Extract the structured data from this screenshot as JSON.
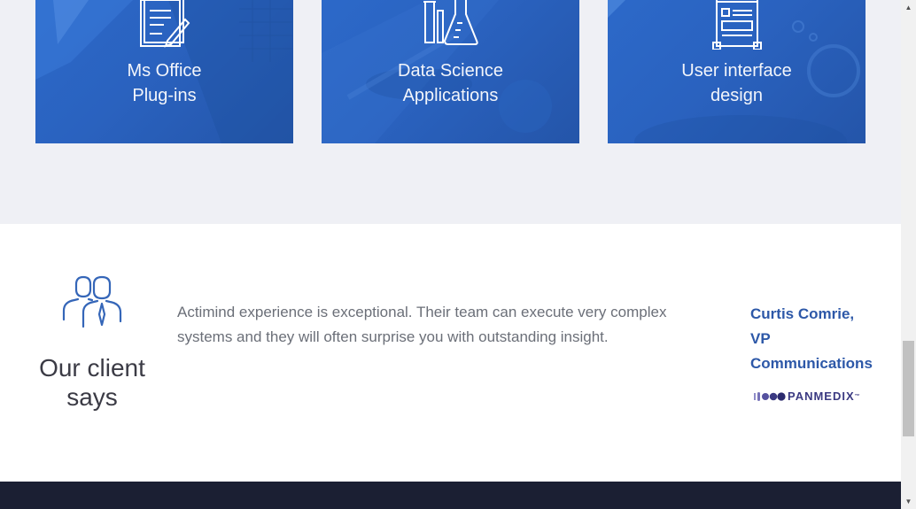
{
  "services": {
    "cards": [
      {
        "line1": "Ms Office",
        "line2": "Plug-ins",
        "icon": "documents-pen-icon"
      },
      {
        "line1": "Data Science",
        "line2": "Applications",
        "icon": "lab-flask-icon"
      },
      {
        "line1": "User interface",
        "line2": "design",
        "icon": "ui-wireframe-icon"
      }
    ]
  },
  "testimonial": {
    "heading_line1": "Our client",
    "heading_line2": "says",
    "quote": "Actimind experience is exceptional. Their team can execute very complex systems and they will often surprise you with outstanding insight.",
    "author_line1": "Curtis Comrie,",
    "author_line2": "VP",
    "author_line3": "Communications",
    "company_logo_text": "PANMEDIX",
    "company_logo_tm": "™"
  },
  "colors": {
    "card_blue": "#2a62bf",
    "section_bg": "#eff0f5",
    "author_blue": "#2d58a8",
    "icon_blue": "#3566b8",
    "footer": "#1b1f33"
  }
}
